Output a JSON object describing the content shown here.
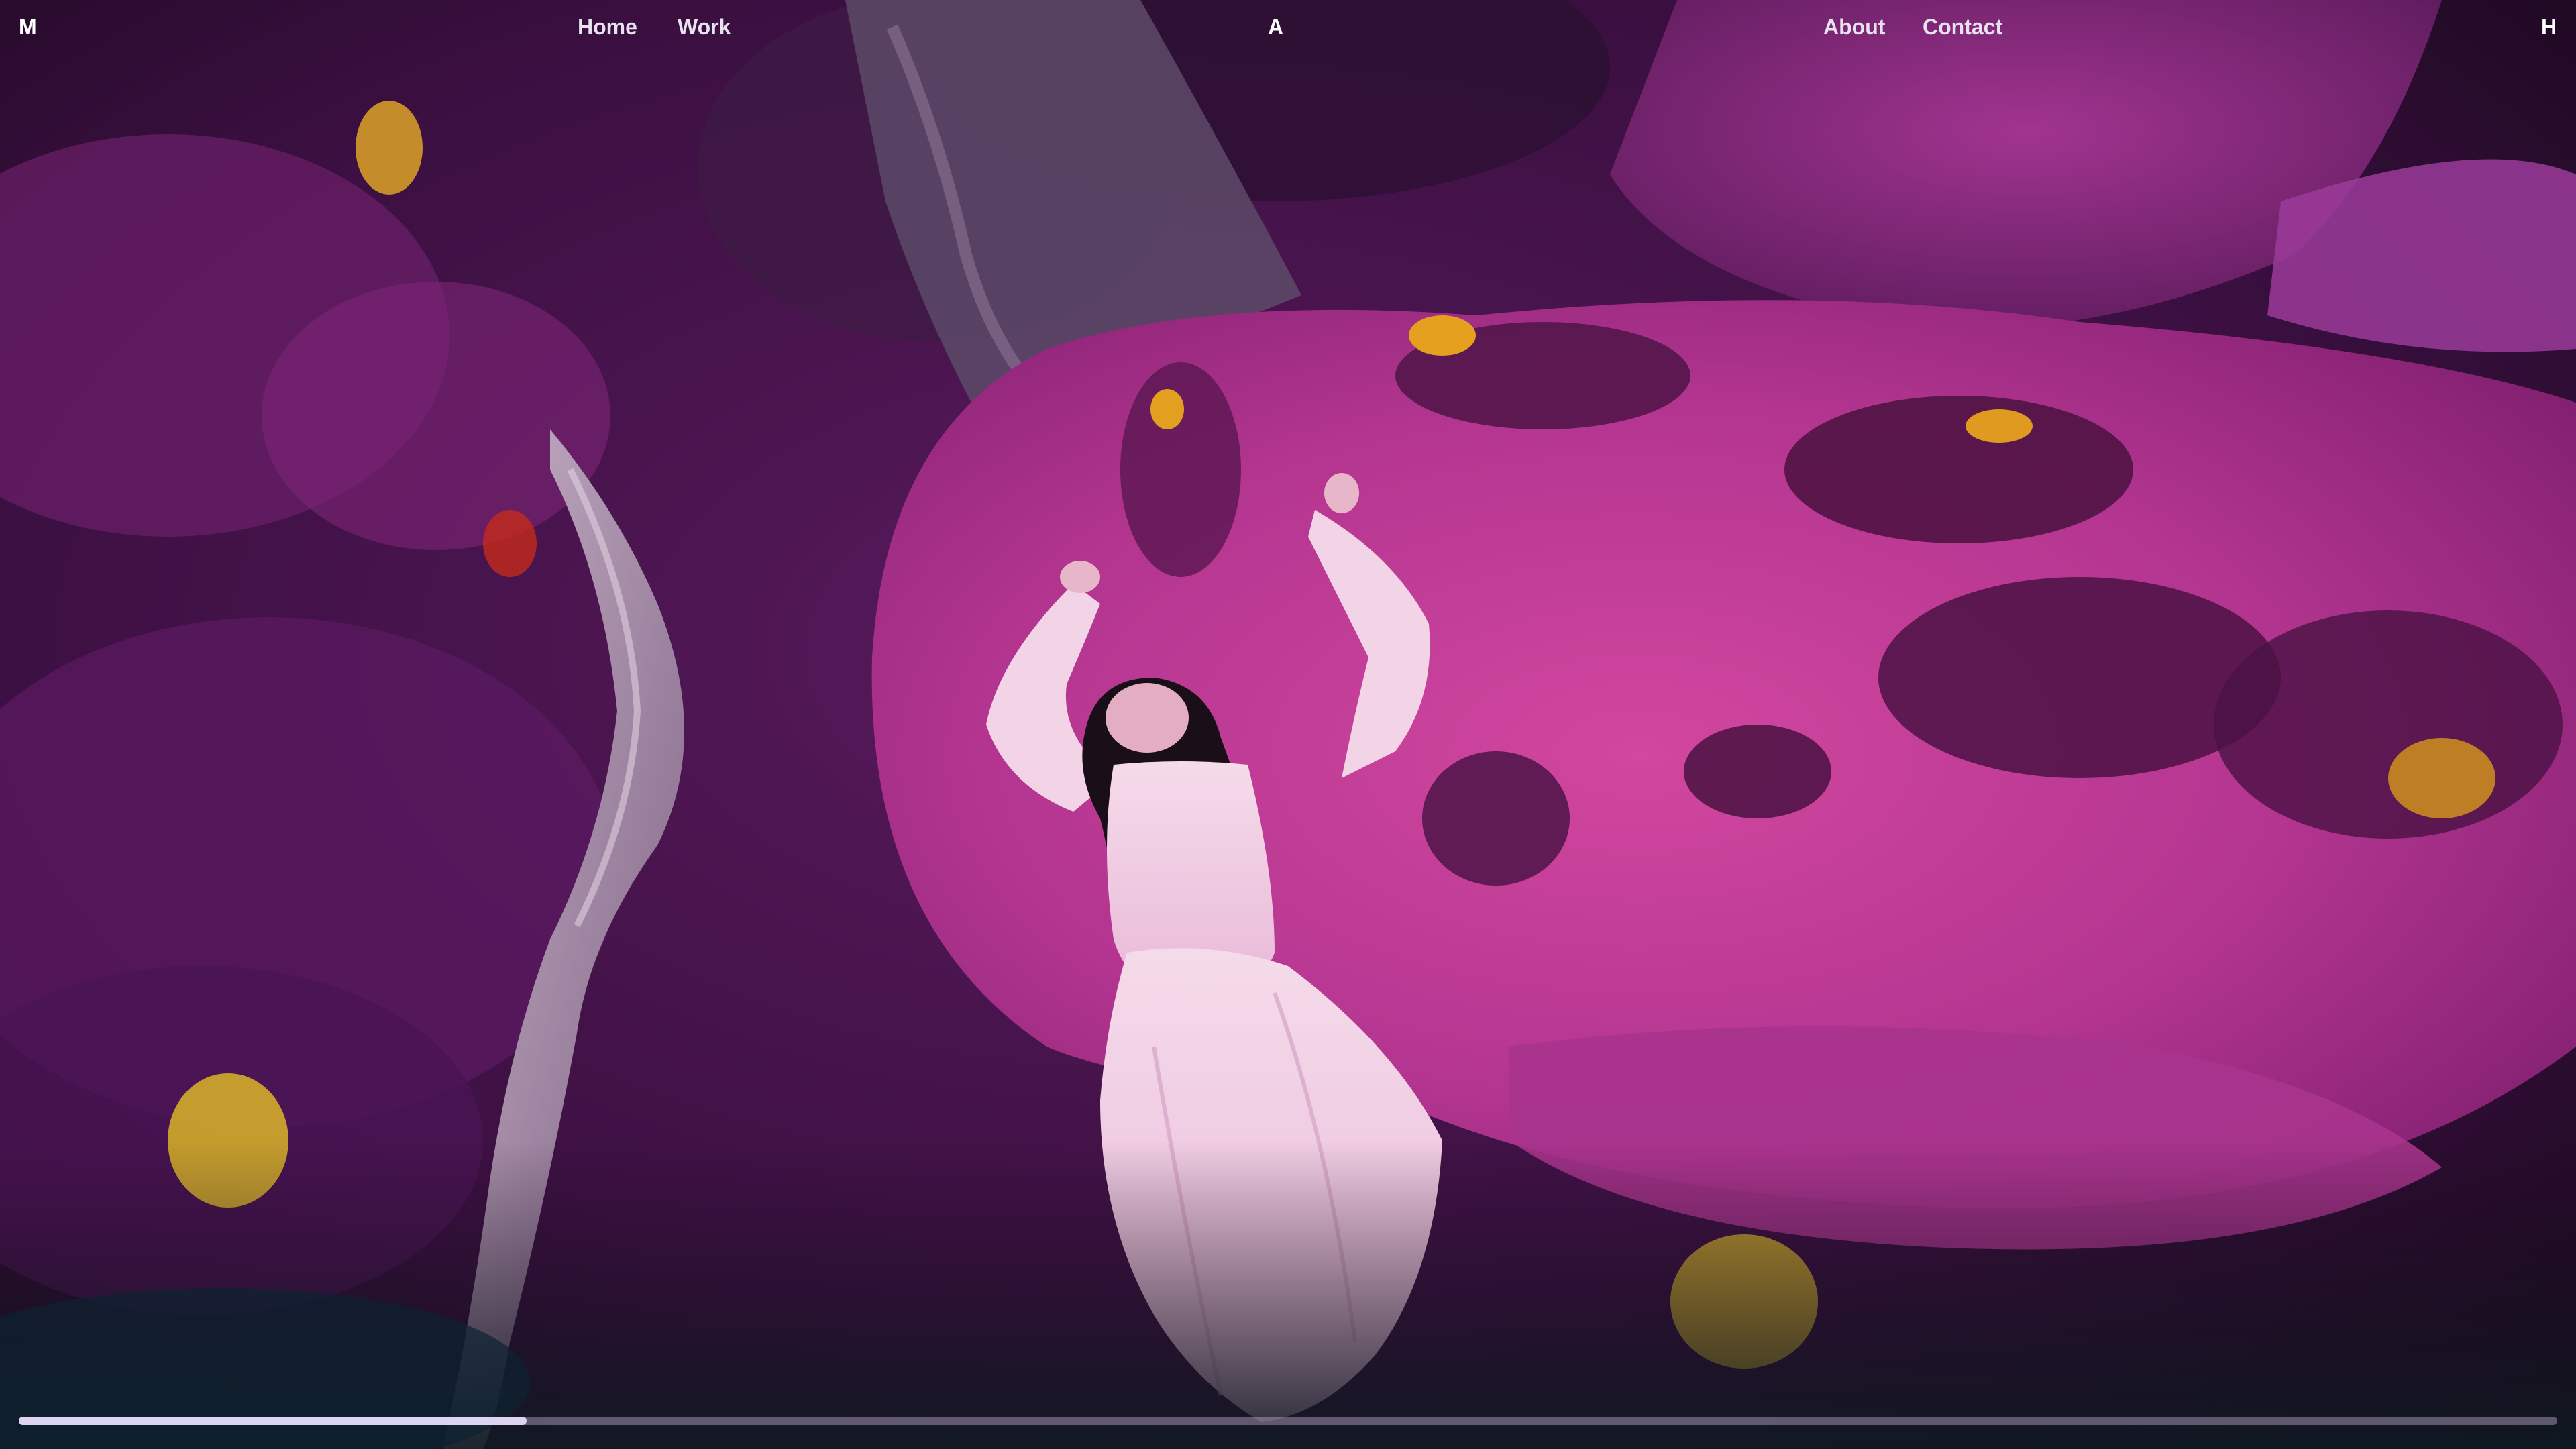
{
  "nav": {
    "logo_left": "M",
    "home_label": "Home",
    "work_label": "Work",
    "center_letter": "A",
    "about_label": "About",
    "contact_label": "Contact",
    "logo_right": "H"
  },
  "video": {
    "progress": 0.2
  },
  "colors": {
    "nav_text": "#ffffff",
    "progress_track": "#b9a9c9",
    "progress_fill": "#ded4f2",
    "scene_magenta": "#c0398e",
    "scene_purple": "#5e1b62",
    "dress": "#f3d2e6"
  }
}
